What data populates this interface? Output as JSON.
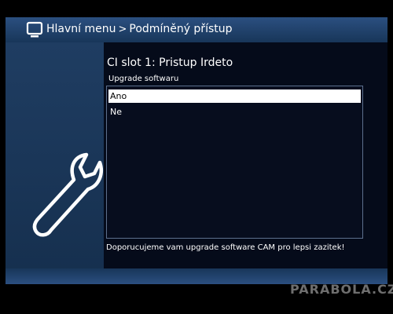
{
  "header": {
    "icon": "tv-icon",
    "breadcrumb_root": "Hlavní menu",
    "breadcrumb_separator": ">",
    "breadcrumb_current": "Podmíněný přístup"
  },
  "sidebar": {
    "icon": "wrench-icon"
  },
  "main": {
    "slot_title": "CI slot 1: Pristup Irdeto",
    "subtitle": "Upgrade softwaru",
    "options": [
      {
        "label": "Ano",
        "selected": true
      },
      {
        "label": "Ne",
        "selected": false
      }
    ],
    "info_text": "Doporucujeme vam upgrade software CAM pro lepsi zazitek!"
  },
  "watermark": "PARABOLA.CZ",
  "colors": {
    "bar_blue": "#2b4f80",
    "panel_blue": "#1f3d62",
    "content_bg": "#050b1a",
    "selected_bg": "#ffffff"
  }
}
